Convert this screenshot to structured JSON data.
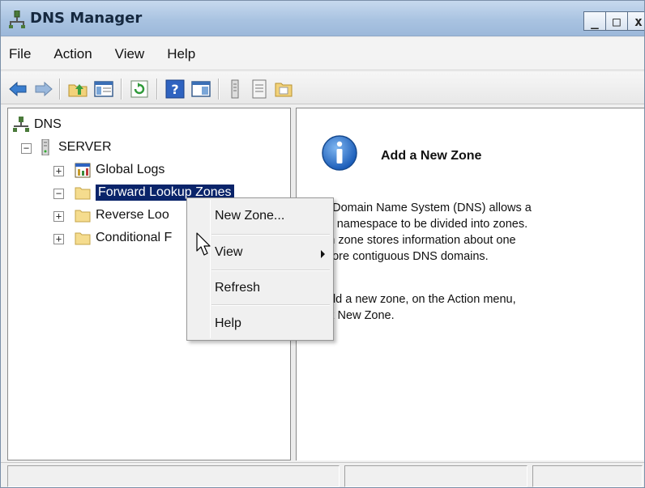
{
  "window": {
    "title": "DNS Manager",
    "controls": {
      "minimize": "_",
      "maximize": "□",
      "close": "x"
    }
  },
  "menubar": {
    "items": [
      "File",
      "Action",
      "View",
      "Help"
    ]
  },
  "toolbar": {
    "icons": [
      "back-icon",
      "forward-icon",
      "up-folder-icon",
      "show-hide-console-tree-icon",
      "refresh-icon",
      "help-icon",
      "console-icon",
      "server-icon",
      "list-icon",
      "folder-icon"
    ]
  },
  "tree": {
    "root": "DNS",
    "server": "SERVER",
    "nodes": [
      "Global Logs",
      "Forward Lookup Zones",
      "Reverse Loo",
      "Conditional F"
    ],
    "selected": "Forward Lookup Zones"
  },
  "detail": {
    "heading": "Add a New Zone",
    "paragraph1": [
      "e Domain Name System (DNS) allows a",
      "IS namespace to be divided into zones.",
      "ch zone stores information about one",
      "more contiguous DNS domains."
    ],
    "paragraph2": [
      "add a new zone, on the Action menu,",
      "ck New Zone."
    ]
  },
  "context_menu": {
    "items": [
      {
        "label": "New Zone...",
        "submenu": false
      },
      {
        "label": "View",
        "submenu": true
      },
      {
        "label": "Refresh",
        "submenu": false
      },
      {
        "label": "Help",
        "submenu": false
      }
    ]
  },
  "colors": {
    "selection": "#0a246a",
    "titlebar": "#a9c3e1",
    "info_icon": "#1f6fc5"
  }
}
